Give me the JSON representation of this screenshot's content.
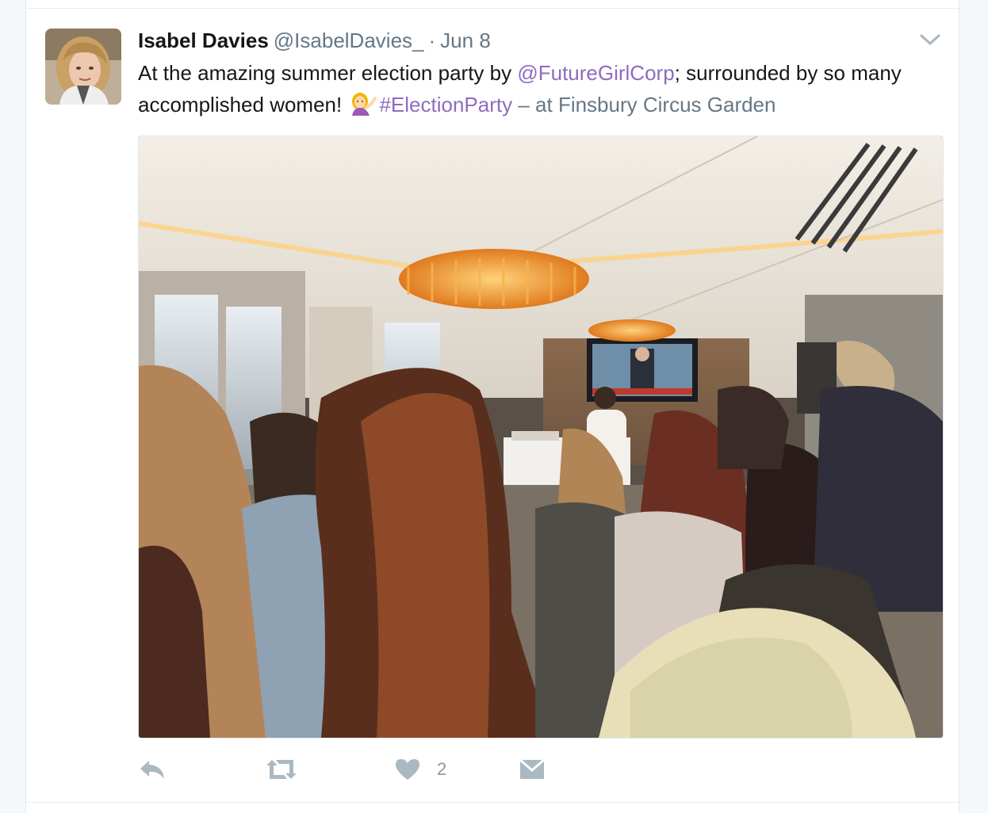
{
  "tweet": {
    "author": {
      "name": "Isabel Davies",
      "handle": "@IsabelDavies_"
    },
    "separator": "·",
    "time": "Jun 8",
    "text": {
      "part1": "At the amazing summer election party by ",
      "mention": "@FutureGirlCorp",
      "part2": "; surrounded by so many accomplished women! ",
      "emoji": "information-desk-person-emoji",
      "hashtag": "#ElectionParty",
      "location": " – at Finsbury Circus Garden"
    },
    "media": {
      "type": "photo",
      "icon": "photo-of-election-party-room"
    },
    "actions": {
      "reply": {
        "icon": "reply-icon"
      },
      "retweet": {
        "icon": "retweet-icon"
      },
      "like": {
        "icon": "heart-icon",
        "count": "2"
      },
      "message": {
        "icon": "direct-message-icon"
      }
    },
    "menu_icon": "chevron-down-icon"
  },
  "colors": {
    "link": "#8e6bbf",
    "text": "#14171a",
    "muted": "#657786",
    "action": "#aab8c2",
    "background": "#f5f8fa"
  }
}
